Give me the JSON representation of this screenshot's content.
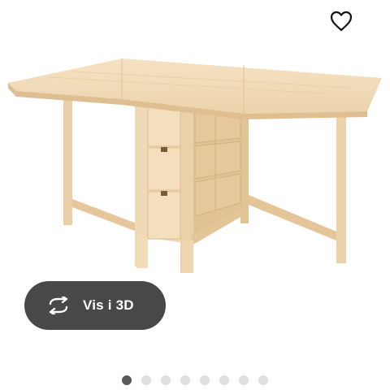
{
  "image": {
    "alt": ""
  },
  "view_3d": {
    "label": "Vis i 3D"
  },
  "carousel": {
    "total": 8,
    "active_index": 0
  },
  "colors": {
    "button_bg": "#484848",
    "button_text": "#ffffff",
    "dot_active": "#5a5a5a",
    "dot_inactive": "#dfdfdf",
    "wood_light": "#f3dcb8",
    "wood_mid": "#e7c89c",
    "wood_shadow": "#d6b484"
  },
  "icons": {
    "favorite": "heart-outline-icon",
    "rotate": "rotate-3d-icon"
  }
}
